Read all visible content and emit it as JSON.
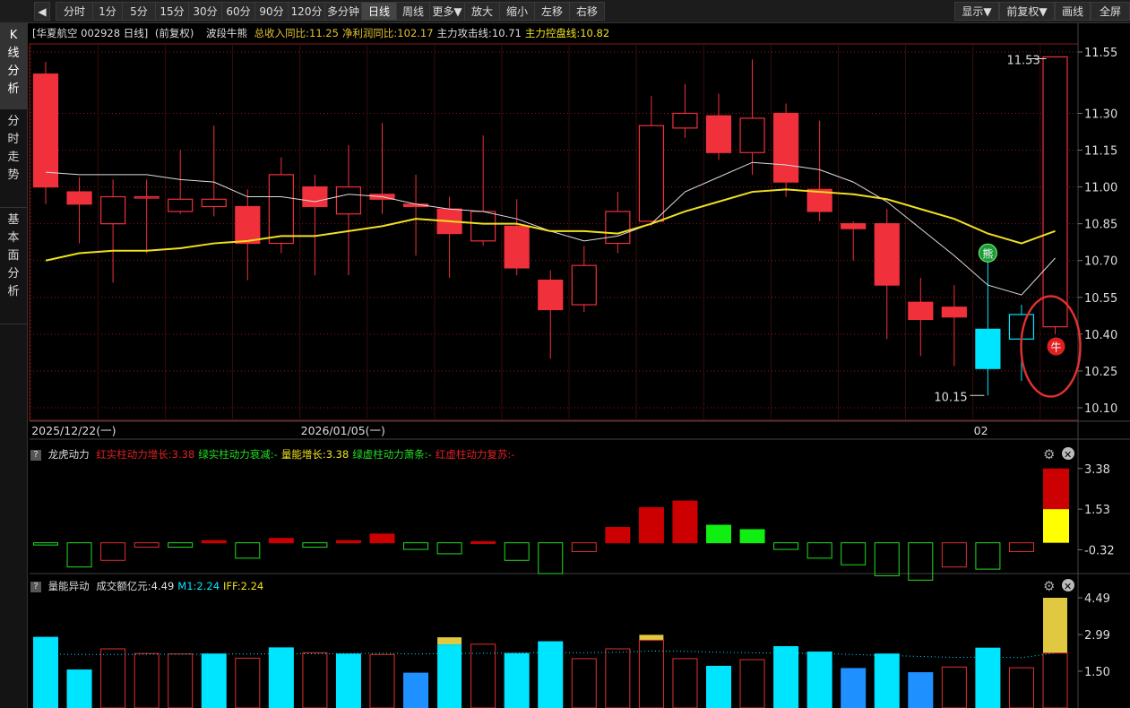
{
  "toolbar": {
    "back_icon": "back-triangle-icon",
    "items": [
      "分时",
      "1分",
      "5分",
      "15分",
      "30分",
      "60分",
      "90分",
      "120分",
      "多分钟",
      "日线",
      "周线",
      "更多▼",
      "放大",
      "缩小",
      "左移",
      "右移"
    ],
    "active": "日线",
    "right_items": [
      "显示▼",
      "前复权▼",
      "画线",
      "全屏"
    ]
  },
  "sidetabs": [
    "K\n线\n分\n析",
    "分\n时\n走\n势",
    "基\n本\n面\n分\n析"
  ],
  "header": {
    "stock": "[华夏航空 002928 日线]",
    "adjust": "(前复权)",
    "indicator_name": "波段牛熊",
    "items": [
      {
        "text": "总收入同比:11.25",
        "color": "#e0c030"
      },
      {
        "text": "净利润同比:102.17",
        "color": "#e0c030"
      },
      {
        "text": "主力攻击线:10.71",
        "color": "#dddddd"
      },
      {
        "text": "主力控盘线:10.82",
        "color": "#f0e020"
      }
    ]
  },
  "colors": {
    "up": "#f0303a",
    "down_body": "#f0303a",
    "cyan": "#00e5ff",
    "yellow": "#f0e020",
    "white": "#dddddd",
    "green": "#22dd22",
    "blue": "#1e90ff",
    "grid": "#8b1a1a"
  },
  "chart_data": [
    {
      "type": "candlestick",
      "title": "波段牛熊",
      "ylim": [
        10.1,
        11.55
      ],
      "yticks": [
        "11.55",
        "11.30",
        "11.15",
        "11.00",
        "10.85",
        "10.70",
        "10.55",
        "10.40",
        "10.25",
        "10.10"
      ],
      "date_labels": [
        {
          "index": 0,
          "text": "2025/12/22(一)"
        },
        {
          "index": 8,
          "text": "2026/01/05(一)"
        },
        {
          "index": 28,
          "text": "02"
        }
      ],
      "annotations": {
        "high_label": "11.53",
        "low_label": "10.15",
        "bear_marker": "熊",
        "bull_marker": "牛"
      },
      "candles": [
        {
          "o": 11.46,
          "c": 11.0,
          "h": 11.51,
          "l": 10.93,
          "t": "down"
        },
        {
          "o": 10.98,
          "c": 10.93,
          "h": 11.04,
          "l": 10.77,
          "t": "down"
        },
        {
          "o": 10.96,
          "c": 10.85,
          "h": 11.03,
          "l": 10.61,
          "t": "up"
        },
        {
          "o": 10.96,
          "c": 10.96,
          "h": 11.03,
          "l": 10.73,
          "t": "flat"
        },
        {
          "o": 10.95,
          "c": 10.9,
          "h": 11.15,
          "l": 10.89,
          "t": "up"
        },
        {
          "o": 10.95,
          "c": 10.92,
          "h": 11.25,
          "l": 10.88,
          "t": "up"
        },
        {
          "o": 10.92,
          "c": 10.77,
          "h": 10.99,
          "l": 10.62,
          "t": "down"
        },
        {
          "o": 10.77,
          "c": 11.05,
          "h": 11.12,
          "l": 10.73,
          "t": "up"
        },
        {
          "o": 11.0,
          "c": 10.92,
          "h": 11.05,
          "l": 10.64,
          "t": "down"
        },
        {
          "o": 10.89,
          "c": 11.0,
          "h": 11.17,
          "l": 10.64,
          "t": "up"
        },
        {
          "o": 10.97,
          "c": 10.95,
          "h": 11.26,
          "l": 10.89,
          "t": "down"
        },
        {
          "o": 10.93,
          "c": 10.92,
          "h": 11.05,
          "l": 10.72,
          "t": "down"
        },
        {
          "o": 10.91,
          "c": 10.81,
          "h": 10.96,
          "l": 10.63,
          "t": "down"
        },
        {
          "o": 10.78,
          "c": 10.9,
          "h": 11.21,
          "l": 10.76,
          "t": "up"
        },
        {
          "o": 10.84,
          "c": 10.67,
          "h": 10.95,
          "l": 10.64,
          "t": "down"
        },
        {
          "o": 10.62,
          "c": 10.5,
          "h": 10.66,
          "l": 10.3,
          "t": "down"
        },
        {
          "o": 10.52,
          "c": 10.68,
          "h": 10.76,
          "l": 10.49,
          "t": "up"
        },
        {
          "o": 10.77,
          "c": 10.9,
          "h": 10.98,
          "l": 10.73,
          "t": "up"
        },
        {
          "o": 10.86,
          "c": 11.25,
          "h": 11.37,
          "l": 10.84,
          "t": "up"
        },
        {
          "o": 11.24,
          "c": 11.3,
          "h": 11.42,
          "l": 11.2,
          "t": "up"
        },
        {
          "o": 11.29,
          "c": 11.14,
          "h": 11.38,
          "l": 11.11,
          "t": "down"
        },
        {
          "o": 11.14,
          "c": 11.28,
          "h": 11.52,
          "l": 11.05,
          "t": "up"
        },
        {
          "o": 11.3,
          "c": 11.02,
          "h": 11.34,
          "l": 10.96,
          "t": "down"
        },
        {
          "o": 10.99,
          "c": 10.9,
          "h": 11.27,
          "l": 10.86,
          "t": "down"
        },
        {
          "o": 10.85,
          "c": 10.83,
          "h": 10.86,
          "l": 10.7,
          "t": "down"
        },
        {
          "o": 10.85,
          "c": 10.6,
          "h": 10.91,
          "l": 10.38,
          "t": "down"
        },
        {
          "o": 10.53,
          "c": 10.46,
          "h": 10.63,
          "l": 10.31,
          "t": "down"
        },
        {
          "o": 10.51,
          "c": 10.47,
          "h": 10.6,
          "l": 10.27,
          "t": "down"
        },
        {
          "o": 10.42,
          "c": 10.26,
          "h": 10.76,
          "l": 10.15,
          "t": "cyan"
        },
        {
          "o": 10.38,
          "c": 10.48,
          "h": 10.52,
          "l": 10.21,
          "t": "cyanup"
        },
        {
          "o": 10.43,
          "c": 11.53,
          "h": 11.53,
          "l": 10.4,
          "t": "up"
        }
      ],
      "series": [
        {
          "name": "主力攻击线",
          "values": [
            11.06,
            11.05,
            11.05,
            11.05,
            11.03,
            11.02,
            10.96,
            10.96,
            10.94,
            10.97,
            10.96,
            10.93,
            10.91,
            10.9,
            10.87,
            10.82,
            10.78,
            10.8,
            10.85,
            10.98,
            11.04,
            11.1,
            11.09,
            11.07,
            11.02,
            10.94,
            10.83,
            10.72,
            10.6,
            10.56,
            10.71
          ]
        },
        {
          "name": "主力控盘线",
          "values": [
            10.7,
            10.73,
            10.74,
            10.74,
            10.75,
            10.77,
            10.78,
            10.8,
            10.8,
            10.82,
            10.84,
            10.87,
            10.86,
            10.85,
            10.85,
            10.82,
            10.82,
            10.81,
            10.85,
            10.9,
            10.94,
            10.98,
            10.99,
            10.98,
            10.97,
            10.95,
            10.91,
            10.87,
            10.81,
            10.77,
            10.82
          ]
        }
      ]
    },
    {
      "type": "bar",
      "title": "龙虎动力",
      "legend": [
        {
          "text": "红实柱动力增长:3.38",
          "color": "#e02020"
        },
        {
          "text": "绿实柱动力衰减:-",
          "color": "#22dd22"
        },
        {
          "text": "量能增长:3.38",
          "color": "#f0e020"
        },
        {
          "text": "绿虚柱动力萧条:-",
          "color": "#22dd22"
        },
        {
          "text": "红虚柱动力复苏:-",
          "color": "#e02020"
        }
      ],
      "ylim": [
        -1.4,
        3.9
      ],
      "yticks": [
        "3.38",
        "1.53",
        "-0.32"
      ],
      "values": [
        -0.1,
        -1.1,
        -0.8,
        -0.2,
        -0.2,
        0.1,
        -0.7,
        0.2,
        -0.2,
        0.1,
        0.4,
        -0.3,
        -0.5,
        0.05,
        -0.8,
        -1.4,
        -0.4,
        0.7,
        1.6,
        1.9,
        0.8,
        0.6,
        -0.3,
        -0.7,
        -1.0,
        -1.5,
        -1.7,
        -1.1,
        -1.2,
        -0.4,
        3.38
      ],
      "styles": [
        "ho",
        "go",
        "ro",
        "ro",
        "go",
        "rf",
        "go",
        "rf",
        "go",
        "rf",
        "rf",
        "go",
        "go",
        "rf",
        "go",
        "go",
        "ro",
        "rf",
        "rf",
        "rf",
        "gf",
        "gf",
        "go",
        "go",
        "go",
        "go",
        "go",
        "ro",
        "go",
        "ro",
        "ry"
      ]
    },
    {
      "type": "bar",
      "title": "量能异动",
      "legend": [
        {
          "text": "成交额亿元:4.49",
          "color": "#dddddd"
        },
        {
          "text": "M1:2.24",
          "color": "#00e5ff"
        },
        {
          "text": "IFF:2.24",
          "color": "#f0e020"
        }
      ],
      "ylim": [
        0,
        4.49
      ],
      "yticks": [
        "4.49",
        "2.99",
        "1.50"
      ],
      "values": [
        2.88,
        1.55,
        2.41,
        2.22,
        2.2,
        2.2,
        2.03,
        2.45,
        2.25,
        2.2,
        2.18,
        1.42,
        2.88,
        2.6,
        2.22,
        2.7,
        2.01,
        2.41,
        2.98,
        2.01,
        1.7,
        1.97,
        2.5,
        2.28,
        1.61,
        2.2,
        1.44,
        1.67,
        2.44,
        1.64,
        4.49
      ],
      "styles": [
        "cf",
        "cf",
        "ro",
        "ro",
        "ro",
        "cf",
        "ro",
        "cf",
        "ro",
        "cf",
        "ro",
        "bf",
        "cy",
        "ro",
        "cf",
        "cf",
        "ro",
        "ro",
        "ry",
        "ro",
        "cf",
        "ro",
        "cf",
        "cf",
        "bf",
        "cf",
        "bf",
        "ro",
        "cf",
        "ro",
        "yr"
      ]
    }
  ]
}
